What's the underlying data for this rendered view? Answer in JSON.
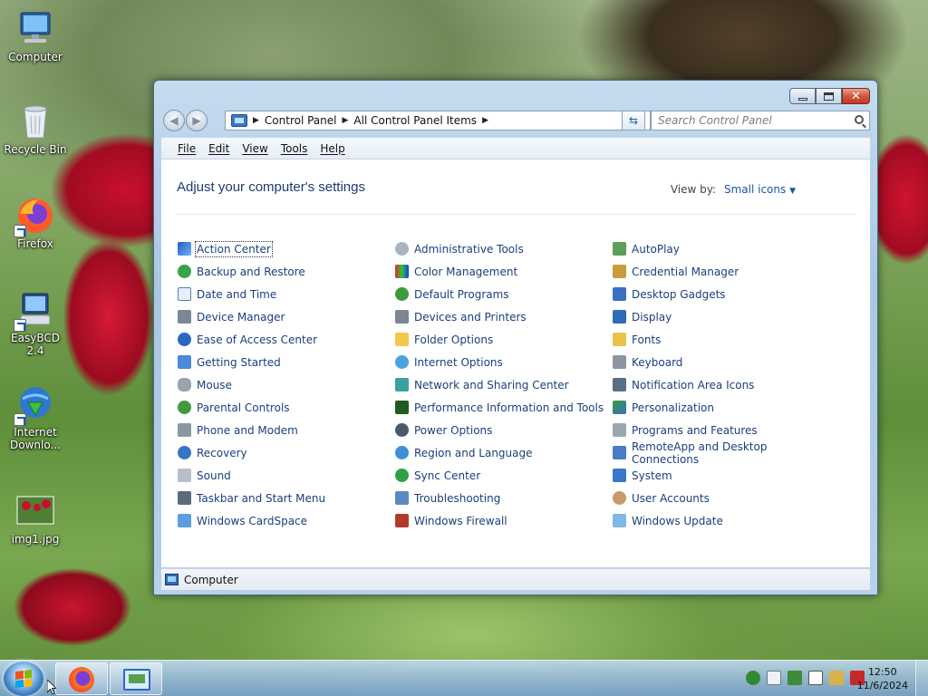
{
  "desktop": {
    "icons": [
      {
        "label": "Computer"
      },
      {
        "label": "Recycle Bin"
      },
      {
        "label": "Firefox"
      },
      {
        "label": "EasyBCD 2.4"
      },
      {
        "label": "Internet Downlo..."
      },
      {
        "label": "img1.jpg"
      }
    ]
  },
  "window": {
    "address": {
      "crumbs": [
        "Control Panel",
        "All Control Panel Items"
      ]
    },
    "search": {
      "placeholder": "Search Control Panel"
    },
    "menu": [
      "File",
      "Edit",
      "View",
      "Tools",
      "Help"
    ],
    "heading": "Adjust your computer's settings",
    "view_by_label": "View by:",
    "view_by_value": "Small icons",
    "columns": [
      [
        "Action Center",
        "Backup and Restore",
        "Date and Time",
        "Device Manager",
        "Ease of Access Center",
        "Getting Started",
        "Mouse",
        "Parental Controls",
        "Phone and Modem",
        "Recovery",
        "Sound",
        "Taskbar and Start Menu",
        "Windows CardSpace"
      ],
      [
        "Administrative Tools",
        "Color Management",
        "Default Programs",
        "Devices and Printers",
        "Folder Options",
        "Internet Options",
        "Network and Sharing Center",
        "Performance Information and Tools",
        "Power Options",
        "Region and Language",
        "Sync Center",
        "Troubleshooting",
        "Windows Firewall"
      ],
      [
        "AutoPlay",
        "Credential Manager",
        "Desktop Gadgets",
        "Display",
        "Fonts",
        "Keyboard",
        "Notification Area Icons",
        "Personalization",
        "Programs and Features",
        "RemoteApp and Desktop Connections",
        "System",
        "User Accounts",
        "Windows Update"
      ]
    ],
    "status_text": "Computer"
  },
  "taskbar": {
    "time": "12:50",
    "date": "11/6/2024"
  },
  "colors": {
    "link": "#1a3f7c",
    "heading": "#1e3a6e",
    "accent": "#1a56a6"
  }
}
